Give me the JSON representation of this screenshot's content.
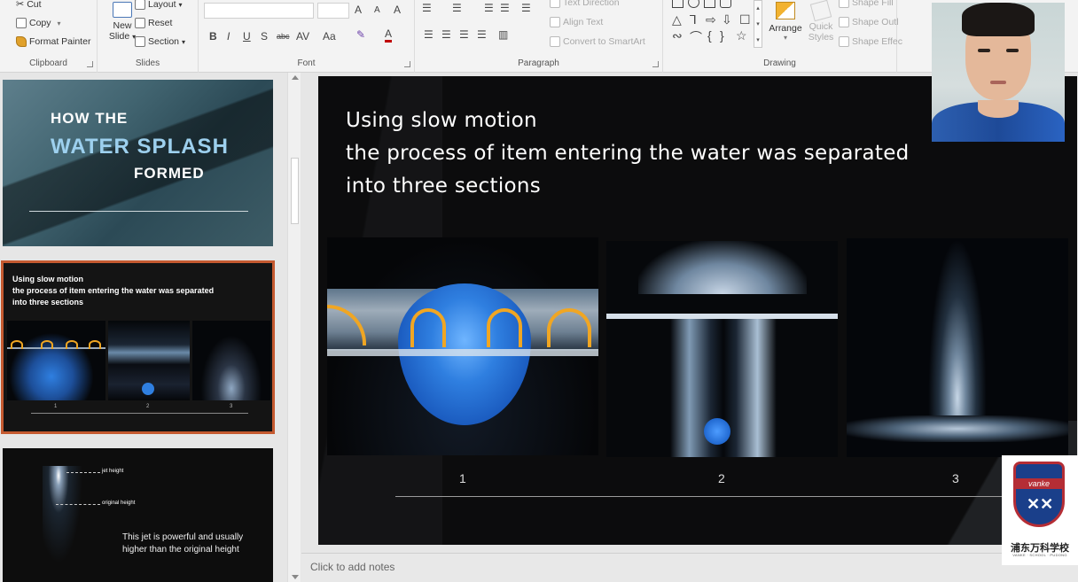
{
  "ribbon": {
    "clipboard": {
      "cut": "Cut",
      "copy": "Copy",
      "format_painter": "Format Painter",
      "label": "Clipboard"
    },
    "slides": {
      "new_slide_line1": "New",
      "new_slide_line2": "Slide",
      "layout": "Layout",
      "reset": "Reset",
      "section": "Section",
      "label": "Slides"
    },
    "font": {
      "label": "Font",
      "bold": "B",
      "italic": "I",
      "underline": "U",
      "shadow": "S",
      "strike": "abc",
      "spacing": "AV",
      "case": "Aa",
      "grow": "A",
      "shrink": "A",
      "clear": "A",
      "font_color": "A"
    },
    "paragraph": {
      "label": "Paragraph",
      "text_direction": "Text Direction",
      "align_text": "Align Text",
      "convert_smartart": "Convert to SmartArt"
    },
    "drawing": {
      "label": "Drawing",
      "arrange": "Arrange",
      "quick_styles_line1": "Quick",
      "quick_styles_line2": "Styles",
      "shape_fill": "Shape Fill",
      "shape_outline": "Shape Outl",
      "shape_effects": "Shape Effec"
    }
  },
  "thumbnails": [
    {
      "line1": "HOW THE",
      "line2": "WATER SPLASH",
      "line3": "FORMED"
    },
    {
      "line1": "Using slow motion",
      "line2": "the process of item entering the water was separated",
      "line3": "into three sections",
      "captions": [
        "1",
        "2",
        "3"
      ]
    },
    {
      "label_jet": "jet height",
      "label_original": "original height",
      "body_line1": "This jet is powerful and usually",
      "body_line2": "higher than the original height"
    }
  ],
  "slide": {
    "title_line1": "Using slow motion",
    "title_line2": "the process of item entering the water was separated",
    "title_line3": "into three sections",
    "captions": [
      "1",
      "2",
      "3"
    ]
  },
  "notes": {
    "placeholder": "Click to add notes"
  },
  "logo": {
    "band": "vanke",
    "cn": "浦东万科学校",
    "en": "VANKE · SCHOOL · PUDONG"
  },
  "colors": {
    "selected_outline": "#c55a30",
    "slide_bg": "#0c0c0d",
    "splash_blue": "#2f7fe0",
    "arrow_orange": "#f0a623"
  }
}
